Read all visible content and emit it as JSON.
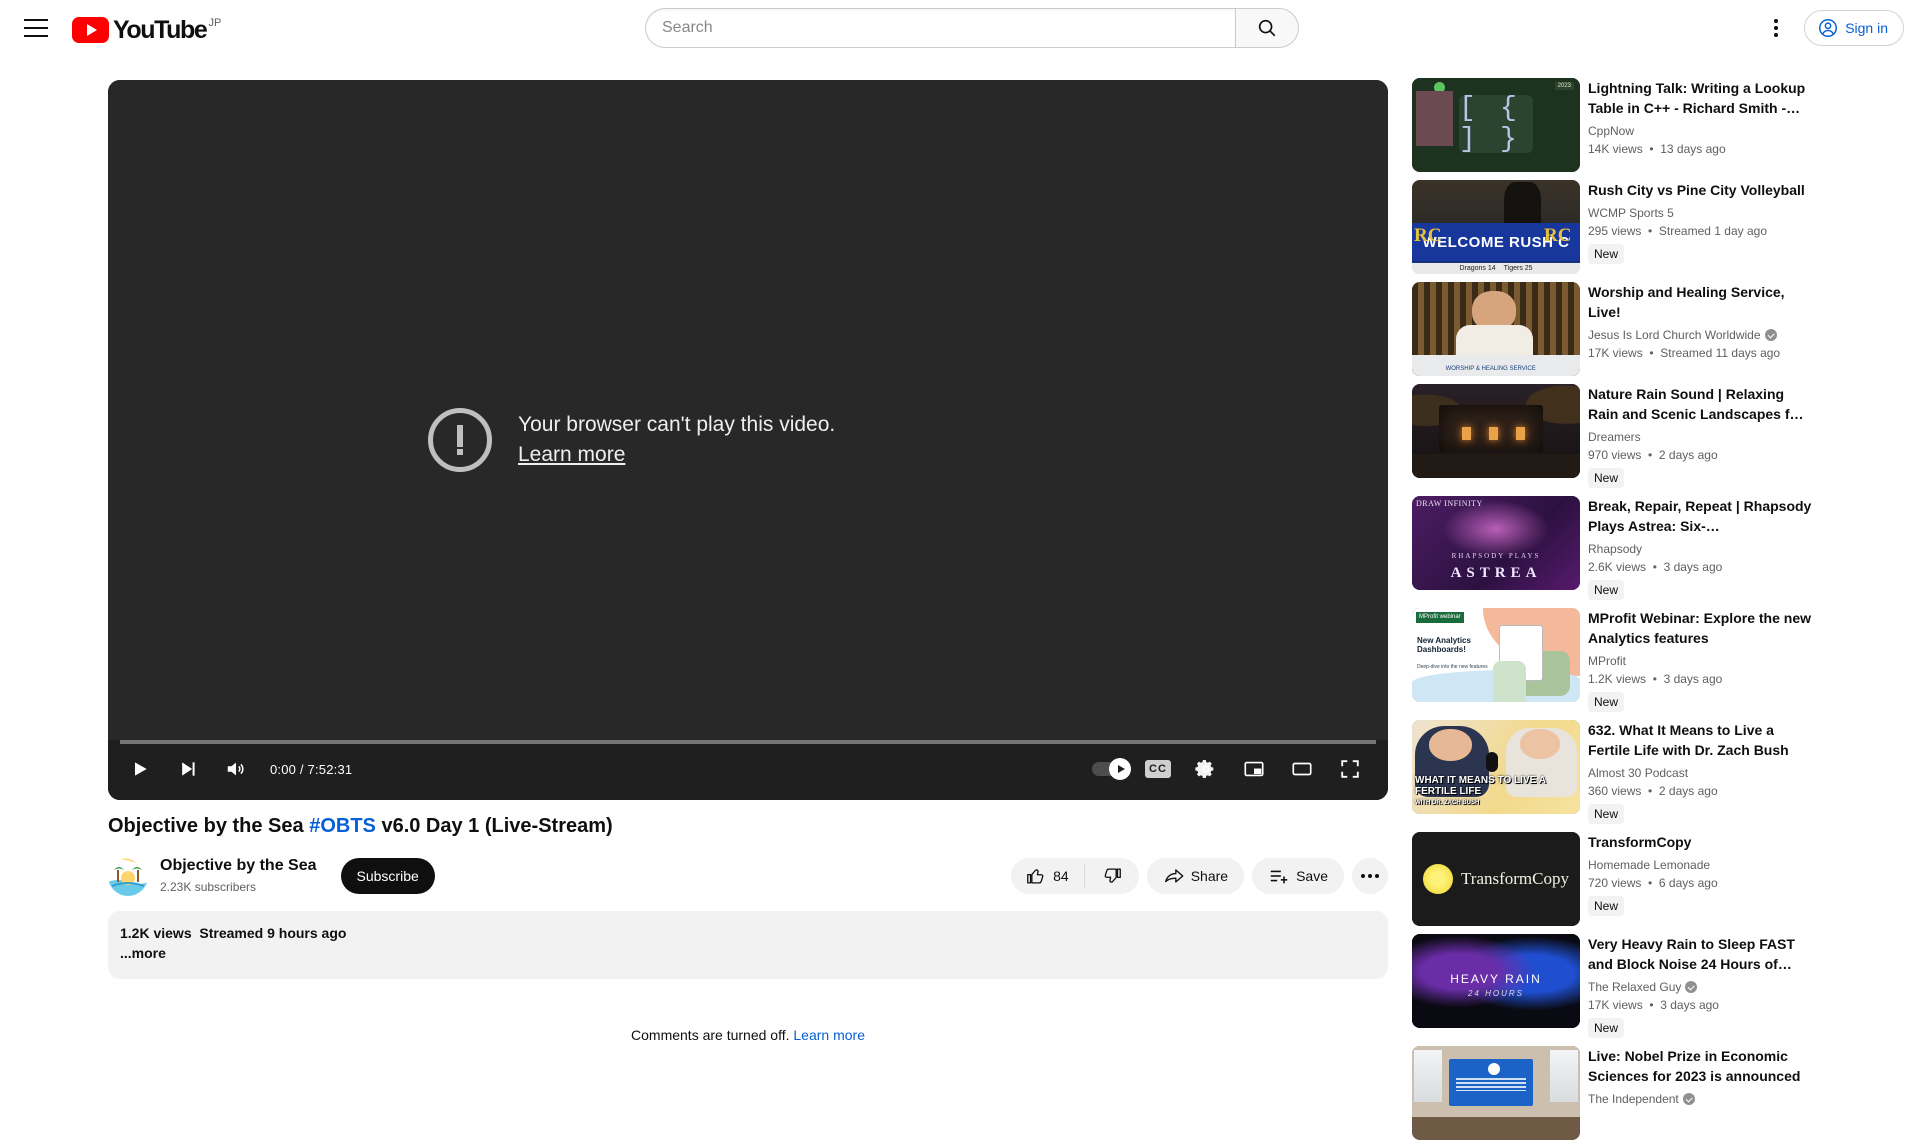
{
  "masthead": {
    "menu_icon": "hamburger-menu-icon",
    "logo_text": "YouTube",
    "logo_country": "JP",
    "search": {
      "value": "",
      "placeholder": "Search",
      "icon": "search-icon"
    },
    "more_icon": "kebab-menu-icon",
    "signin_label": "Sign in",
    "signin_icon": "account-circle-icon"
  },
  "player": {
    "error_message": "Your browser can't play this video.",
    "error_link": "Learn more",
    "error_icon": "exclamation-circle-icon",
    "current_time": "0:00",
    "duration": "7:52:31",
    "time_display": "0:00 / 7:52:31",
    "progress_percent": 0,
    "controls": {
      "play": "play-button",
      "next": "next-video-button",
      "mute": "mute-button",
      "autoplay": "autoplay-toggle",
      "captions": "CC",
      "settings": "settings-gear-button",
      "miniplayer": "miniplayer-button",
      "theater": "theater-mode-button",
      "fullscreen": "fullscreen-button"
    }
  },
  "video": {
    "title_part1": "Objective by the Sea ",
    "title_hashtag": "#OBTS",
    "title_part2": " v6.0 Day 1 (Live-Stream)",
    "channel_name": "Objective by the Sea",
    "channel_subscribers": "2.23K subscribers",
    "subscribe_label": "Subscribe",
    "like_count": "84",
    "share_label": "Share",
    "save_label": "Save",
    "more_actions": "•••",
    "views": "1.2K views",
    "published": "Streamed 9 hours ago",
    "more_label": "...more"
  },
  "comments": {
    "message": "Comments are turned off.",
    "link": "Learn more"
  },
  "related": [
    {
      "title": "Lightning Talk: Writing a Lookup Table in C++ - Richard Smith -…",
      "channel": "CppNow",
      "verified": false,
      "views": "14K views",
      "age": "13 days ago",
      "new": false,
      "thumb": "tn-cpp"
    },
    {
      "title": "Rush City vs Pine City Volleyball",
      "channel": "WCMP Sports 5",
      "verified": false,
      "views": "295 views",
      "age": "Streamed 1 day ago",
      "new": true,
      "thumb": "tn-vb"
    },
    {
      "title": "Worship and Healing Service, Live!",
      "channel": "Jesus Is Lord Church Worldwide",
      "verified": true,
      "views": "17K views",
      "age": "Streamed 11 days ago",
      "new": false,
      "thumb": "tn-worship"
    },
    {
      "title": "Nature Rain Sound | Relaxing Rain and Scenic Landscapes f…",
      "channel": "Dreamers",
      "verified": false,
      "views": "970 views",
      "age": "2 days ago",
      "new": true,
      "thumb": "tn-rain"
    },
    {
      "title": "Break, Repair, Repeat | Rhapsody Plays Astrea: Six-…",
      "channel": "Rhapsody",
      "verified": false,
      "views": "2.6K views",
      "age": "3 days ago",
      "new": true,
      "thumb": "tn-astrea"
    },
    {
      "title": "MProfit Webinar: Explore the new Analytics features",
      "channel": "MProfit",
      "verified": false,
      "views": "1.2K views",
      "age": "3 days ago",
      "new": true,
      "thumb": "tn-mprofit"
    },
    {
      "title": "632. What It Means to Live a Fertile Life with Dr. Zach Bush",
      "channel": "Almost 30 Podcast",
      "verified": false,
      "views": "360 views",
      "age": "2 days ago",
      "new": true,
      "thumb": "tn-podcast"
    },
    {
      "title": "TransformCopy",
      "channel": "Homemade Lemonade",
      "verified": false,
      "views": "720 views",
      "age": "6 days ago",
      "new": true,
      "thumb": "tn-transform"
    },
    {
      "title": "Very Heavy Rain to Sleep FAST and Block Noise 24 Hours of…",
      "channel": "The Relaxed Guy",
      "verified": true,
      "views": "17K views",
      "age": "3 days ago",
      "new": true,
      "thumb": "tn-heavy"
    },
    {
      "title": "Live: Nobel Prize in Economic Sciences for 2023 is announced",
      "channel": "The Independent",
      "verified": true,
      "views": "",
      "age": "",
      "new": false,
      "thumb": "tn-nobel"
    }
  ],
  "thumb_art": {
    "cpp_year": "2023",
    "cpp_brackets_a": "[ ]",
    "cpp_brackets_b": "{ }",
    "vb_banner": "WELCOME RUSH C",
    "vb_left": "RC",
    "vb_right": "RC",
    "vb_score_a": "Dragons 14",
    "vb_score_b": "Tigers 25",
    "worship_caption": "WORSHIP & HEALING SERVICE",
    "astrea_draw": "DRAW INFINITY",
    "astrea_sub": "RHAPSODY PLAYS",
    "astrea_title": "ASTREA",
    "mprofit_logo": "MProfit webinar",
    "mprofit_head": "New Analytics Dashboards!",
    "mprofit_sub": "Deep-dive into the new features",
    "podcast_cap": "WHAT IT MEANS TO LIVE A FERTILE LIFE",
    "podcast_sub": "WITH DR. ZACH BUSH",
    "transform_text": "TransformCopy",
    "heavy_t1": "HEAVY RAIN",
    "heavy_t2": "24 HOURS"
  },
  "colors": {
    "brand_red": "#FF0000",
    "link_blue": "#065fd4",
    "text_primary": "#0f0f0f",
    "text_secondary": "#606060",
    "chip_bg": "#f2f2f2",
    "player_bg": "#282828"
  }
}
